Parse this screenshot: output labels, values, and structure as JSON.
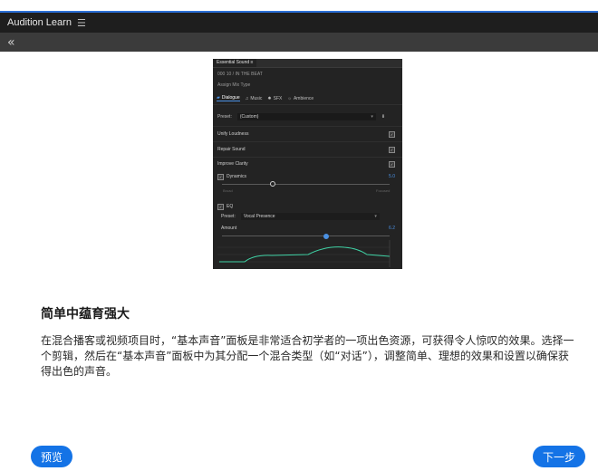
{
  "app": {
    "title": "Audition Learn",
    "menu_icon": "hamburger-icon",
    "back_icon": "double-chevron-left-icon"
  },
  "panel": {
    "tab_title": "Essential Sound",
    "clip_name": "000 10 / IN THE BEAT",
    "assign_label": "Assign Mix Type",
    "mix_types": [
      {
        "label": "Dialogue",
        "icon": "speech-bubble-icon"
      },
      {
        "label": "Music",
        "icon": "music-note-icon"
      },
      {
        "label": "SFX",
        "icon": "sfx-icon"
      },
      {
        "label": "Ambience",
        "icon": "ambience-icon"
      }
    ],
    "preset_label": "Preset:",
    "preset_value": "(Custom)",
    "options": [
      {
        "label": "Unify Loudness",
        "checked": true
      },
      {
        "label": "Repair Sound",
        "checked": true
      },
      {
        "label": "Improve Clarity",
        "checked": true
      }
    ],
    "dynamics": {
      "label": "Dynamics",
      "value": "5.0",
      "left_label": "Broad",
      "right_label": "Focused",
      "level": 0.3
    },
    "eq": {
      "label": "EQ",
      "preset_label": "Preset:",
      "preset_value": "Vocal Presence",
      "amount_label": "Amount",
      "value": "6.2",
      "level": 0.62
    }
  },
  "content": {
    "heading": "简单中蕴育强大",
    "description": "在混合播客或视频项目时，“基本声音”面板是非常适合初学者的一项出色资源，可获得令人惊叹的效果。选择一个剪辑，然后在“基本声音”面板中为其分配一个混合类型（如“对话”），调整简单、理想的效果和设置以确保获得出色的声音。"
  },
  "buttons": {
    "prev": "预览",
    "next": "下一步"
  },
  "colors": {
    "accent": "#1473e6",
    "panel_bg": "#232323",
    "title_bar": "#1e1e1e",
    "graph_line": "#3fd1a4"
  }
}
